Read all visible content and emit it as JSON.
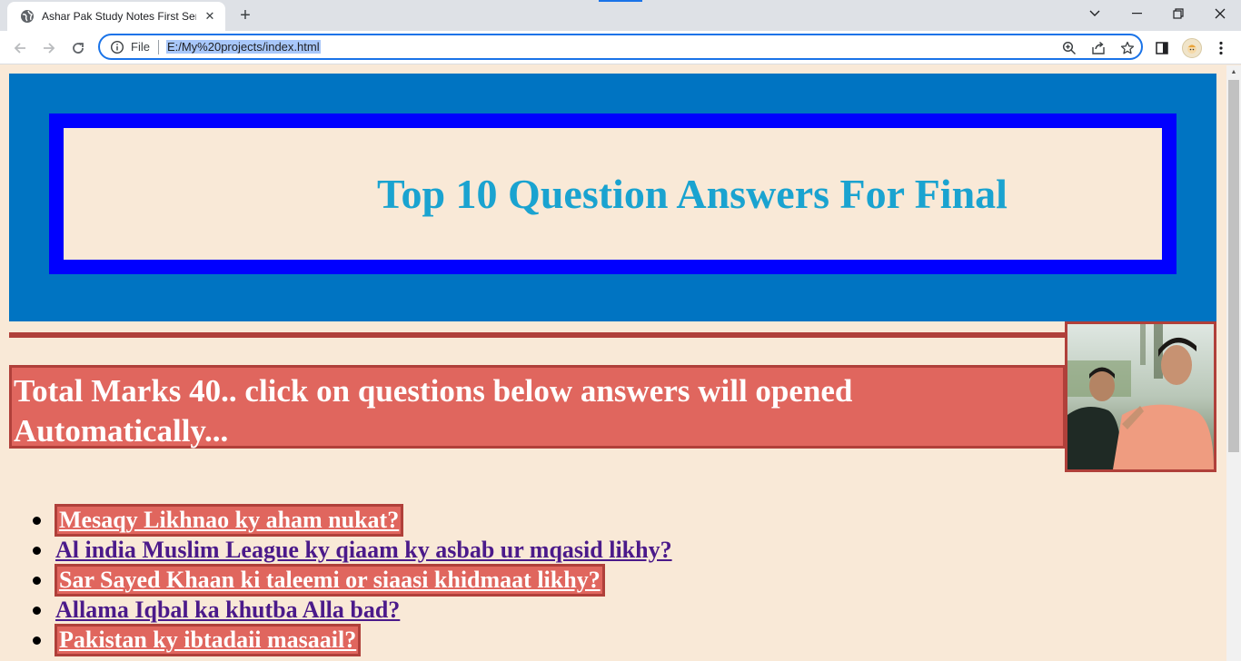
{
  "browser": {
    "tab_title": "Ashar Pak Study Notes First Seme",
    "omnibox_scheme": "File",
    "url": "E:/My%20projects/index.html"
  },
  "page": {
    "hero_title": "Top 10 Question Answers For Final",
    "marks_text": "Total Marks 40.. click on questions below answers will opened Automatically...",
    "questions": [
      {
        "label": "Mesaqy Likhnao ky aham nukat?",
        "style": "boxed"
      },
      {
        "label": "Al india Muslim League ky qiaam ky asbab ur mqasid likhy?",
        "style": "plain"
      },
      {
        "label": "Sar Sayed Khaan ki taleemi or siaasi khidmaat likhy?",
        "style": "boxed"
      },
      {
        "label": "Allama Iqbal ka khutba Alla bad?",
        "style": "plain"
      },
      {
        "label": "Pakistan ky ibtadaii masaail?",
        "style": "boxed"
      }
    ]
  },
  "colors": {
    "page_bg": "#f9e9d7",
    "hero_bg": "#0074c2",
    "hero_frame": "#0000ff",
    "hero_title": "#1aa3d0",
    "accent_red": "#b0403a",
    "marks_bg": "#e0665e",
    "link_visited": "#4b1a8a"
  },
  "icons": {
    "tab_favicon": "globe-icon",
    "info": "info-icon",
    "zoom": "zoom-icon",
    "share": "share-icon",
    "bookmark": "star-icon",
    "side_panel": "side-panel-icon",
    "menu": "kebab-menu-icon"
  }
}
